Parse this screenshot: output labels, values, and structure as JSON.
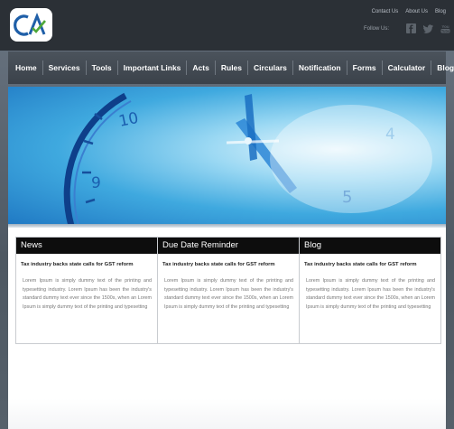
{
  "header": {
    "top_links": [
      "Contact Us",
      "About Us",
      "Blog"
    ],
    "follow_label": "Follow Us:",
    "social_icons": [
      "facebook-icon",
      "twitter-icon",
      "youtube-icon"
    ]
  },
  "nav": {
    "items": [
      "Home",
      "Services",
      "Tools",
      "Important Links",
      "Acts",
      "Rules",
      "Circulars",
      "Notification",
      "Forms",
      "Calculator",
      "Blogs"
    ]
  },
  "hero": {
    "clock_numerals": [
      "10",
      "9",
      "4",
      "5"
    ]
  },
  "columns": [
    {
      "heading": "News",
      "title": "Tax industry backs state calls for GST reform",
      "body": "Lorem Ipsum is simply dummy text of the printing and typesetting industry. Lorem Ipsum has been the industry's standard dummy text ever since the 1500s, when an Lorem Ipsum is simply dummy text of the printing and typesetting"
    },
    {
      "heading": "Due Date Reminder",
      "title": "Tax industry backs state calls for GST reform",
      "body": "Lorem Ipsum is simply dummy text of the printing and typesetting industry. Lorem Ipsum has been the industry's standard dummy text ever since the 1500s, when an Lorem Ipsum is simply dummy text of the printing and typesetting"
    },
    {
      "heading": "Blog",
      "title": "Tax industry backs state calls for GST reform",
      "body": "Lorem Ipsum is simply dummy text of the printing and typesetting industry. Lorem Ipsum has been the industry's standard dummy text ever since the 1500s, when an Lorem Ipsum is simply dummy text of the printing and typesetting"
    }
  ],
  "colors": {
    "header_bg": "#2b3036",
    "nav_bg": "#434a52",
    "column_head_bg": "#0d0d0d",
    "logo_blue": "#1f5fa8",
    "logo_green": "#4fa83a"
  }
}
